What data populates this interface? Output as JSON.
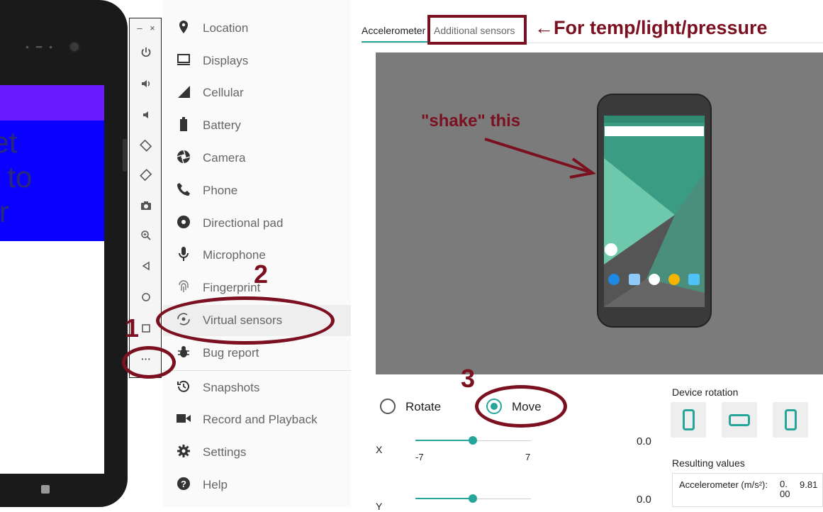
{
  "phone": {
    "text_lines": [
      "get",
      "id to",
      "lor"
    ]
  },
  "toolbar": {
    "minimize": "–",
    "close": "×",
    "icons": [
      "power-icon",
      "volume-up-icon",
      "volume-down-icon",
      "rotate-left-icon",
      "rotate-right-icon",
      "camera-icon",
      "zoom-icon",
      "back-icon",
      "home-icon",
      "overview-icon",
      "more-icon"
    ]
  },
  "sidebar": {
    "items": [
      {
        "label": "Location",
        "icon": "location-icon"
      },
      {
        "label": "Displays",
        "icon": "displays-icon"
      },
      {
        "label": "Cellular",
        "icon": "cellular-icon"
      },
      {
        "label": "Battery",
        "icon": "battery-icon"
      },
      {
        "label": "Camera",
        "icon": "camera-icon"
      },
      {
        "label": "Phone",
        "icon": "phone-icon"
      },
      {
        "label": "Directional pad",
        "icon": "dpad-icon"
      },
      {
        "label": "Microphone",
        "icon": "microphone-icon"
      },
      {
        "label": "Fingerprint",
        "icon": "fingerprint-icon"
      },
      {
        "label": "Virtual sensors",
        "icon": "virtual-sensors-icon"
      },
      {
        "label": "Bug report",
        "icon": "bug-icon"
      },
      {
        "label": "Snapshots",
        "icon": "snapshots-icon"
      },
      {
        "label": "Record and Playback",
        "icon": "record-icon"
      },
      {
        "label": "Settings",
        "icon": "settings-icon"
      },
      {
        "label": "Help",
        "icon": "help-icon"
      }
    ],
    "active": "Virtual sensors"
  },
  "tabs": {
    "accelerometer": "Accelerometer",
    "additional": "Additional sensors"
  },
  "controls": {
    "rotate_label": "Rotate",
    "move_label": "Move",
    "selected": "Move",
    "x_label": "X",
    "y_label": "Y",
    "x_min": "-7",
    "x_max": "7",
    "x_value": "0.0",
    "y_value": "0.0",
    "device_rotation_label": "Device rotation",
    "resulting_values_label": "Resulting values",
    "accelerometer_label": "Accelerometer (m/s²):",
    "accel_v1": "0. 00",
    "accel_v2": "9.81"
  },
  "annotations": {
    "temp": "←For temp/light/pressure",
    "shake": "\"shake\" this",
    "n1": "1",
    "n2": "2",
    "n3": "3"
  },
  "colors": {
    "accent": "#26a69a",
    "annotation": "#7b1020",
    "viewport": "#7b7b7b",
    "phone_blue": "#0a00ff",
    "phone_appbar": "#6a1aff"
  }
}
